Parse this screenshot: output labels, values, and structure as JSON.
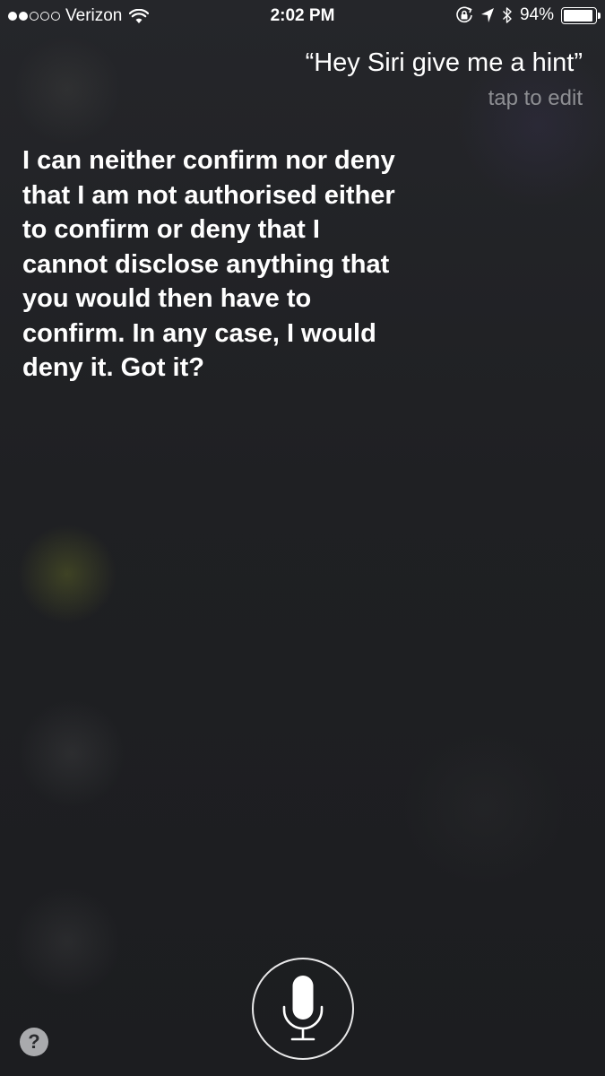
{
  "status_bar": {
    "signal_dots_filled": 2,
    "signal_dots_total": 5,
    "carrier": "Verizon",
    "time": "2:02 PM",
    "battery_percent_label": "94%",
    "battery_level": 0.94,
    "icons": [
      "wifi-icon",
      "orientation-lock-icon",
      "location-arrow-icon",
      "bluetooth-icon",
      "battery-icon"
    ]
  },
  "siri": {
    "query": "“Hey Siri give me a hint”",
    "tap_to_edit": "tap to edit",
    "response_lines": [
      "I can neither confirm nor deny",
      "that I am not authorised either",
      "to confirm or deny that I",
      "cannot disclose anything that",
      "you would then have to",
      "confirm. In any case, I would",
      "deny it. Got it?"
    ]
  },
  "controls": {
    "mic_icon": "microphone-icon",
    "help_label": "?"
  },
  "colors": {
    "background": "#1e1f21",
    "secondary_text": "#8e8f93",
    "help_button": "#a9aaad"
  }
}
